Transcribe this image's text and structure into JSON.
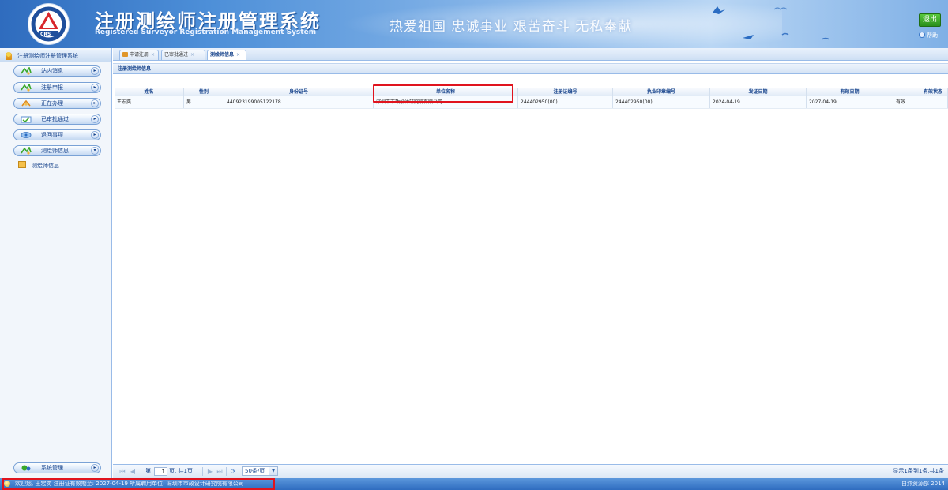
{
  "header": {
    "title_cn": "注册测绘师注册管理系统",
    "title_en": "Registered Surveyor Registration Management System",
    "slogan": "热爱祖国  忠诚事业  艰苦奋斗  无私奉献",
    "logo_text": "CRS",
    "logout_label": "退出",
    "help_label": "帮助"
  },
  "sidebar": {
    "title": "注册测绘师注册管理系统",
    "items": [
      {
        "label": "站内消息",
        "icon": "chat-icon"
      },
      {
        "label": "注册申报",
        "icon": "form-icon"
      },
      {
        "label": "正在办理",
        "icon": "processing-icon"
      },
      {
        "label": "已审批通过",
        "icon": "approved-icon"
      },
      {
        "label": "退回事项",
        "icon": "return-icon"
      },
      {
        "label": "测绘师信息",
        "icon": "info-icon"
      }
    ],
    "sub_item": "测绘师信息",
    "system_label": "系统管理"
  },
  "tabs": [
    {
      "label": "申请注册",
      "close": "×"
    },
    {
      "label": "已审批通过",
      "close": "×"
    },
    {
      "label": "测绘师信息",
      "close": "×",
      "active": true
    }
  ],
  "panel": {
    "title": "注册测绘师信息"
  },
  "table": {
    "columns": [
      "姓名",
      "性别",
      "身份证号",
      "单位名称",
      "注册证编号",
      "执业印章编号",
      "发证日期",
      "有效日期",
      "有效状态"
    ],
    "rows": [
      [
        "王宏奕",
        "男",
        "440923199005122178",
        "深圳市市政设计研究院有限公司",
        "244402950(00)",
        "244402950(00)",
        "2024-04-19",
        "2027-04-19",
        "有效"
      ]
    ]
  },
  "pager": {
    "page_label_pre": "第",
    "page_value": "1",
    "page_label_post": "页, 共1页",
    "page_size": "50条/页",
    "info": "显示1条到1条,共1条"
  },
  "statusbar": {
    "text": "欢迎您, 王宏奕   注册证有效期至: 2027-04-19   所属聘用单位: 深圳市市政设计研究院有限公司",
    "copyright": "自然资源部 2014"
  },
  "colors": {
    "header_blue": "#2f6cbe",
    "nav_text": "#15428b",
    "highlight_red": "#e0141e",
    "logout_green": "#3aa82a"
  }
}
